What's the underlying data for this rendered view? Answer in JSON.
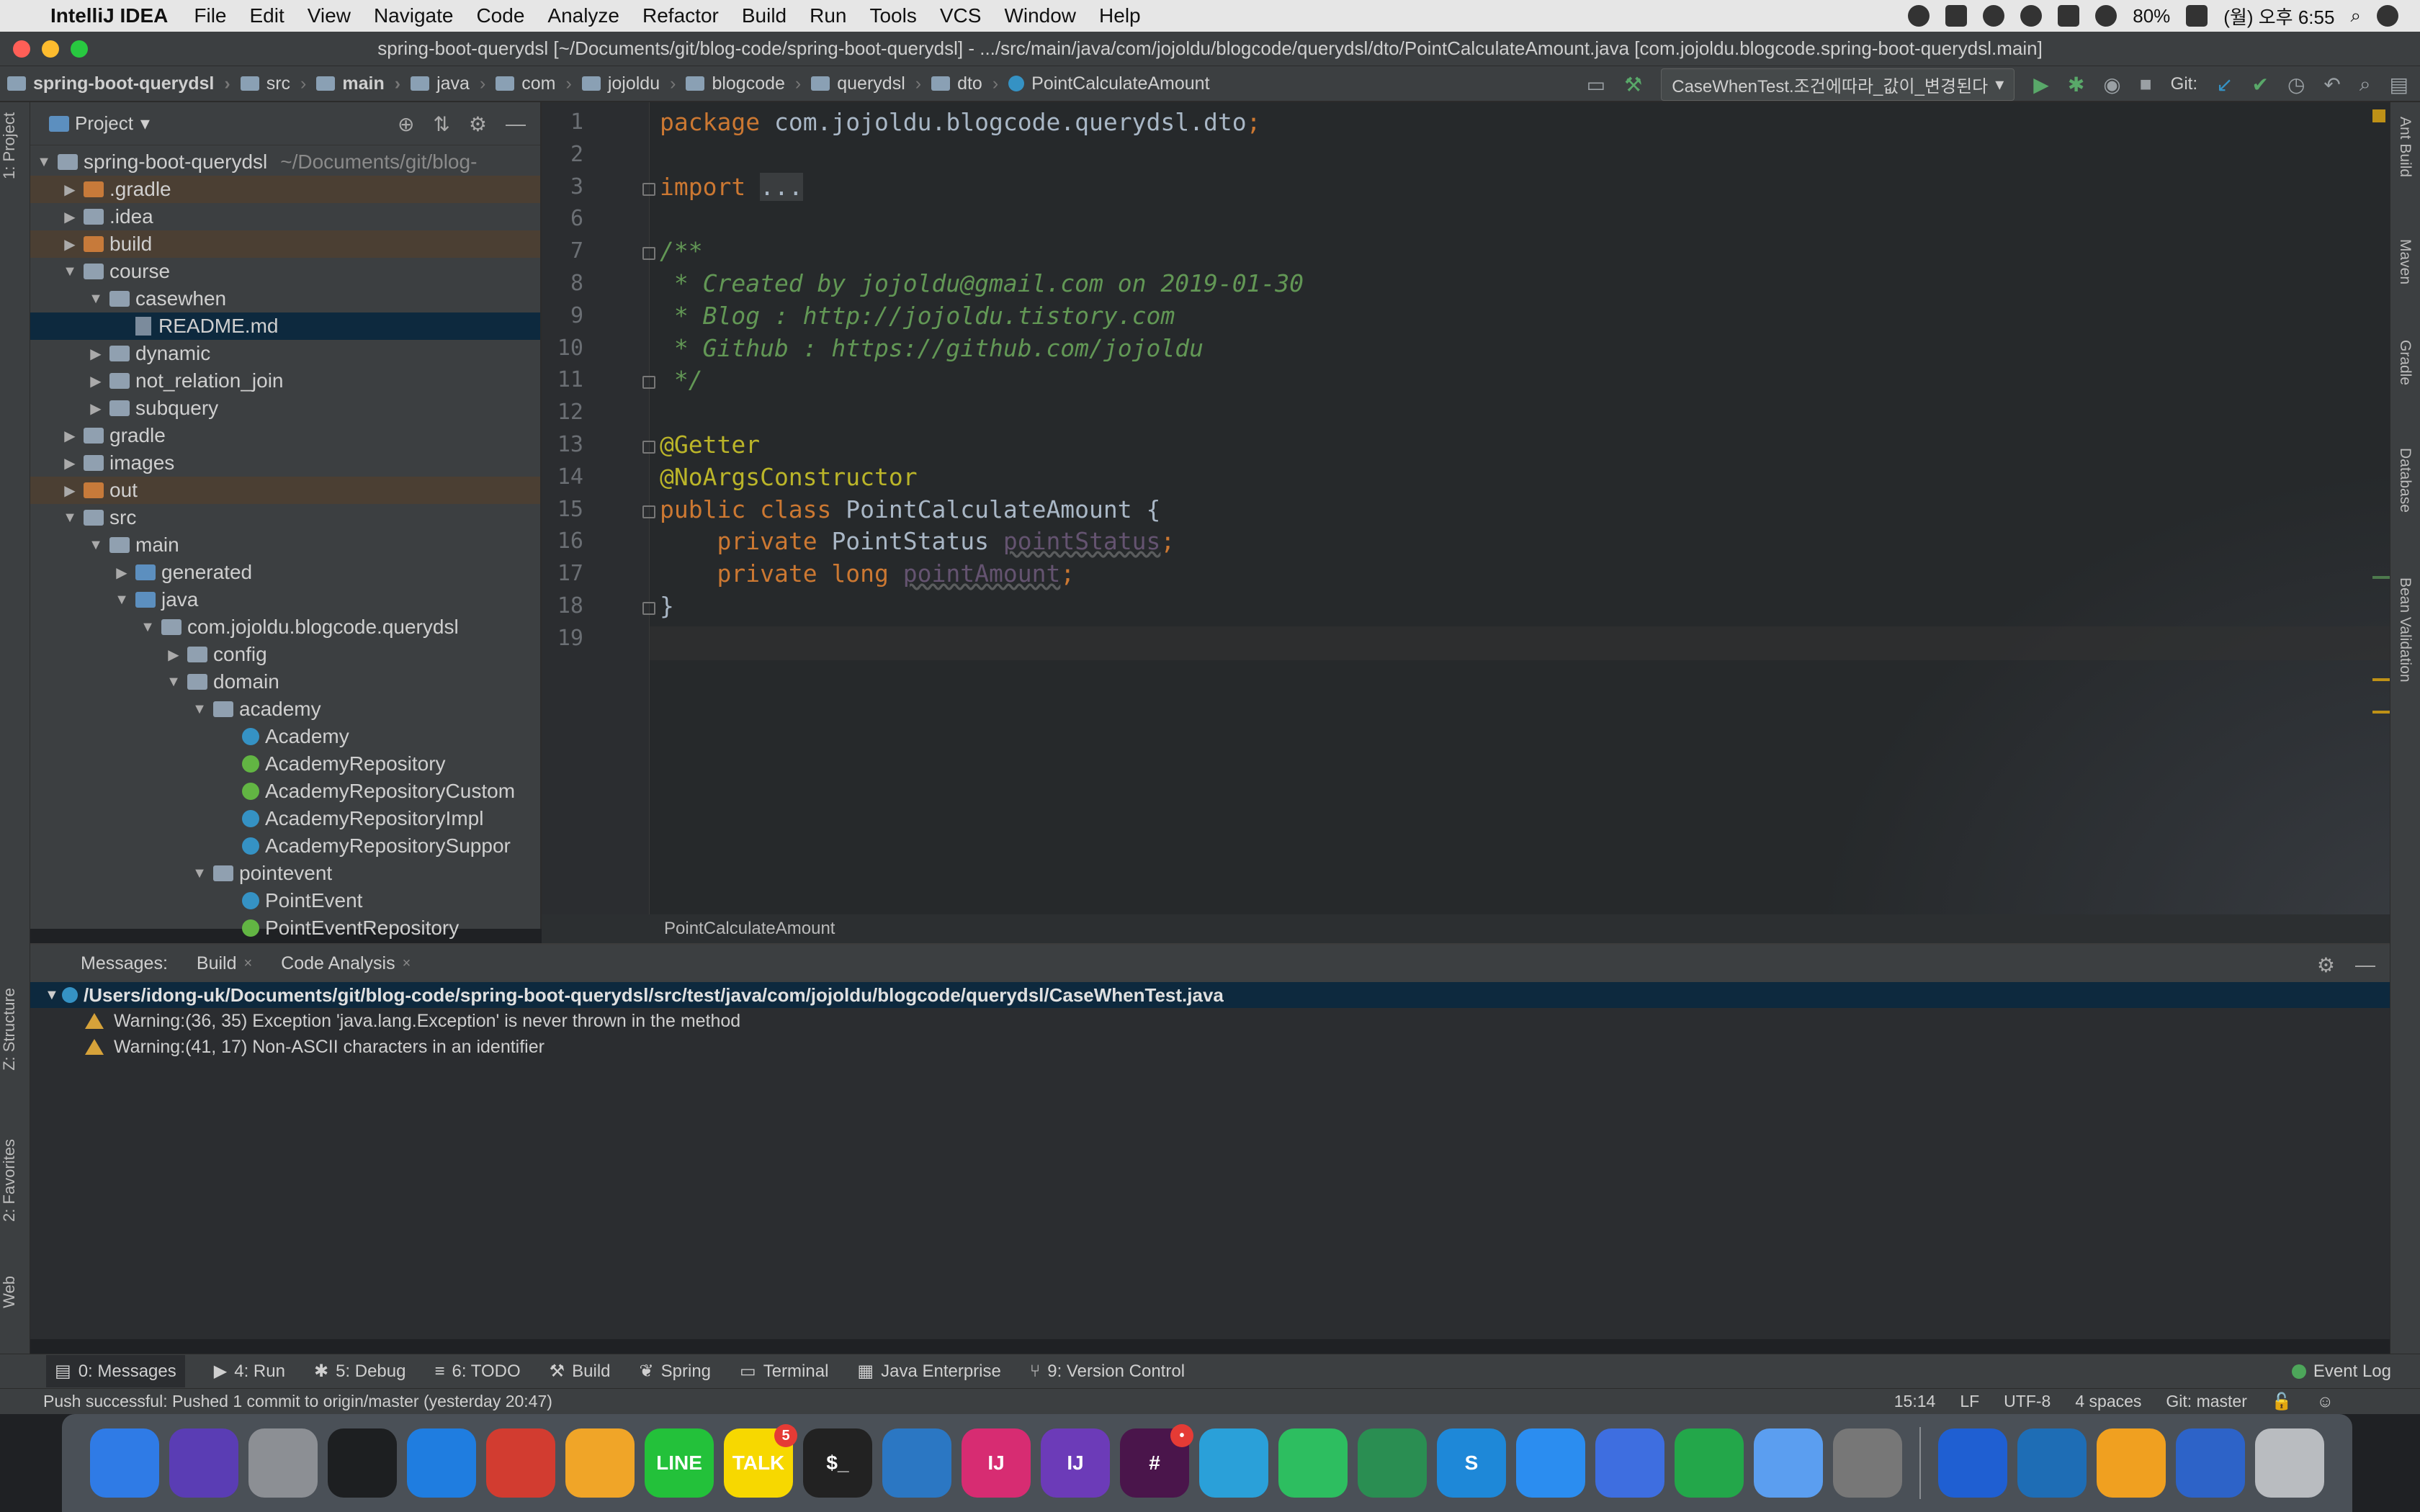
{
  "menubar": {
    "app_name": "IntelliJ IDEA",
    "items": [
      "File",
      "Edit",
      "View",
      "Navigate",
      "Code",
      "Analyze",
      "Refactor",
      "Build",
      "Run",
      "Tools",
      "VCS",
      "Window",
      "Help"
    ],
    "battery": "80%",
    "clock": "(월) 오후 6:55"
  },
  "window": {
    "title": "spring-boot-querydsl [~/Documents/git/blog-code/spring-boot-querydsl] - .../src/main/java/com/jojoldu/blogcode/querydsl/dto/PointCalculateAmount.java [com.jojoldu.blogcode.spring-boot-querydsl.main]"
  },
  "breadcrumbs": [
    "spring-boot-querydsl",
    "src",
    "main",
    "java",
    "com",
    "jojoldu",
    "blogcode",
    "querydsl",
    "dto",
    "PointCalculateAmount"
  ],
  "nav": {
    "run_config": "CaseWhenTest.조건에따라_값이_변경된다",
    "git_label": "Git:"
  },
  "left_stripe": {
    "project": "1: Project",
    "structure": "Z: Structure",
    "favorites": "2: Favorites",
    "web": "Web"
  },
  "right_stripe": [
    "Ant Build",
    "Maven",
    "Gradle",
    "Database",
    "Bean Validation"
  ],
  "project_panel": {
    "title": "Project",
    "root_name": "spring-boot-querydsl",
    "root_path": "~/Documents/git/blog-",
    "tree": [
      {
        "label": ".gradle",
        "depth": 1,
        "type": "folder-orange",
        "arrow": "right"
      },
      {
        "label": ".idea",
        "depth": 1,
        "type": "folder",
        "arrow": "right"
      },
      {
        "label": "build",
        "depth": 1,
        "type": "folder-orange",
        "arrow": "right"
      },
      {
        "label": "course",
        "depth": 1,
        "type": "folder",
        "arrow": "down"
      },
      {
        "label": "casewhen",
        "depth": 2,
        "type": "folder",
        "arrow": "down"
      },
      {
        "label": "README.md",
        "depth": 3,
        "type": "md",
        "arrow": ""
      },
      {
        "label": "dynamic",
        "depth": 2,
        "type": "folder",
        "arrow": "right"
      },
      {
        "label": "not_relation_join",
        "depth": 2,
        "type": "folder",
        "arrow": "right"
      },
      {
        "label": "subquery",
        "depth": 2,
        "type": "folder",
        "arrow": "right"
      },
      {
        "label": "gradle",
        "depth": 1,
        "type": "folder",
        "arrow": "right"
      },
      {
        "label": "images",
        "depth": 1,
        "type": "folder",
        "arrow": "right"
      },
      {
        "label": "out",
        "depth": 1,
        "type": "folder-orange",
        "arrow": "right"
      },
      {
        "label": "src",
        "depth": 1,
        "type": "folder",
        "arrow": "down"
      },
      {
        "label": "main",
        "depth": 2,
        "type": "folder",
        "arrow": "down"
      },
      {
        "label": "generated",
        "depth": 3,
        "type": "folder-blue",
        "arrow": "right"
      },
      {
        "label": "java",
        "depth": 3,
        "type": "folder-blue",
        "arrow": "down"
      },
      {
        "label": "com.jojoldu.blogcode.querydsl",
        "depth": 4,
        "type": "folder",
        "arrow": "down"
      },
      {
        "label": "config",
        "depth": 5,
        "type": "folder",
        "arrow": "right"
      },
      {
        "label": "domain",
        "depth": 5,
        "type": "folder",
        "arrow": "down"
      },
      {
        "label": "academy",
        "depth": 6,
        "type": "folder",
        "arrow": "down"
      },
      {
        "label": "Academy",
        "depth": 7,
        "type": "class",
        "arrow": ""
      },
      {
        "label": "AcademyRepository",
        "depth": 7,
        "type": "interface",
        "arrow": ""
      },
      {
        "label": "AcademyRepositoryCustom",
        "depth": 7,
        "type": "interface",
        "arrow": ""
      },
      {
        "label": "AcademyRepositoryImpl",
        "depth": 7,
        "type": "class",
        "arrow": ""
      },
      {
        "label": "AcademyRepositorySuppor",
        "depth": 7,
        "type": "class",
        "arrow": ""
      },
      {
        "label": "pointevent",
        "depth": 6,
        "type": "folder",
        "arrow": "down"
      },
      {
        "label": "PointEvent",
        "depth": 7,
        "type": "class",
        "arrow": ""
      },
      {
        "label": "PointEventRepository",
        "depth": 7,
        "type": "interface",
        "arrow": ""
      }
    ]
  },
  "editor": {
    "filename": "PointCalculateAmount",
    "lines": [
      {
        "n": "1",
        "html": "<span class='kw'>package</span> <span class='plain'>com.jojoldu.blogcode.querydsl.dto</span><span class='kw'>;</span>"
      },
      {
        "n": "2",
        "html": ""
      },
      {
        "n": "3",
        "html": "<span class='kw'>import</span> <span class='plain' style='background:#3a3d3f'>...</span>"
      },
      {
        "n": "6",
        "html": ""
      },
      {
        "n": "7",
        "html": "<span class='cmt'>/**</span>"
      },
      {
        "n": "8",
        "html": "<span class='cmt'> * Created by jojoldu@gmail.com on 2019-01-30</span>"
      },
      {
        "n": "9",
        "html": "<span class='cmt'> * Blog : http://jojoldu.tistory.com</span>"
      },
      {
        "n": "10",
        "html": "<span class='cmt'> * Github : https://github.com/jojoldu</span>"
      },
      {
        "n": "11",
        "html": "<span class='cmt'> */</span>"
      },
      {
        "n": "12",
        "html": ""
      },
      {
        "n": "13",
        "html": "<span class='ann'>@Getter</span>"
      },
      {
        "n": "14",
        "html": "<span class='ann'>@NoArgsConstructor</span>"
      },
      {
        "n": "15",
        "html": "<span class='kw'>public class</span> <span class='plain'>PointCalculateAmount {</span>"
      },
      {
        "n": "16",
        "html": "    <span class='kw'>private</span> <span class='plain'>PointStatus</span> <span class='field'>pointStatus</span><span class='kw'>;</span>"
      },
      {
        "n": "17",
        "html": "    <span class='kw'>private long</span> <span class='field'>pointAmount</span><span class='kw'>;</span>"
      },
      {
        "n": "18",
        "html": "<span class='plain'>}</span>"
      },
      {
        "n": "19",
        "html": ""
      }
    ]
  },
  "messages": {
    "label": "Messages:",
    "tabs": [
      "Build",
      "Code Analysis"
    ],
    "path": "/Users/idong-uk/Documents/git/blog-code/spring-boot-querydsl/src/test/java/com/jojoldu/blogcode/querydsl/CaseWhenTest.java",
    "warnings": [
      "Warning:(36, 35)  Exception 'java.lang.Exception' is never thrown in the method",
      "Warning:(41, 17)  Non-ASCII characters in an identifier"
    ]
  },
  "tool_windows": [
    "0: Messages",
    "4: Run",
    "5: Debug",
    "6: TODO",
    "Build",
    "Spring",
    "Terminal",
    "Java Enterprise",
    "9: Version Control"
  ],
  "event_log": "Event Log",
  "status": {
    "message": "Push successful: Pushed 1 commit to origin/master (yesterday 20:47)",
    "position": "15:14",
    "line_sep": "LF",
    "encoding": "UTF-8",
    "indent": "4 spaces",
    "git": "Git: master"
  },
  "dock": [
    {
      "name": "finder",
      "color": "#2f7be6",
      "label": ""
    },
    {
      "name": "siri",
      "color": "#5a3db4",
      "label": ""
    },
    {
      "name": "launchpad",
      "color": "#8c8f94",
      "label": ""
    },
    {
      "name": "activity-monitor",
      "color": "#1d1f21",
      "label": ""
    },
    {
      "name": "safari",
      "color": "#1f7de0",
      "label": ""
    },
    {
      "name": "chrome",
      "color": "#d23c30",
      "label": ""
    },
    {
      "name": "chrome-canary",
      "color": "#f0a528",
      "label": ""
    },
    {
      "name": "line",
      "color": "#23c13a",
      "label": "LINE"
    },
    {
      "name": "kakaotalk",
      "color": "#f7d800",
      "label": "TALK",
      "badge": "5"
    },
    {
      "name": "terminal",
      "color": "#222",
      "label": "$_"
    },
    {
      "name": "vscode",
      "color": "#2b77c3",
      "label": ""
    },
    {
      "name": "intellij-idea",
      "color": "#d72c72",
      "label": "IJ"
    },
    {
      "name": "intellij-idea-2",
      "color": "#6c3bb8",
      "label": "IJ"
    },
    {
      "name": "slack",
      "color": "#4a154b",
      "label": "#",
      "badge": "•"
    },
    {
      "name": "telegram",
      "color": "#2aa0d9",
      "label": ""
    },
    {
      "name": "evernote",
      "color": "#2dbe60",
      "label": ""
    },
    {
      "name": "browser",
      "color": "#2a8e52",
      "label": ""
    },
    {
      "name": "s-app",
      "color": "#1e88d8",
      "label": "S"
    },
    {
      "name": "app-store",
      "color": "#2b8df0",
      "label": ""
    },
    {
      "name": "keynote",
      "color": "#3e6ee0",
      "label": ""
    },
    {
      "name": "numbers",
      "color": "#23a74a",
      "label": ""
    },
    {
      "name": "messages",
      "color": "#5b9ef0",
      "label": ""
    },
    {
      "name": "system-preferences",
      "color": "#777",
      "label": ""
    },
    {
      "name": "maps-pin",
      "color": "#1f5fd2",
      "label": ""
    },
    {
      "name": "vscode-2",
      "color": "#1e6db5",
      "label": ""
    },
    {
      "name": "reeder",
      "color": "#f0a020",
      "label": ""
    },
    {
      "name": "downloads",
      "color": "#2d63c8",
      "label": ""
    },
    {
      "name": "trash",
      "color": "#b9bcc0",
      "label": ""
    }
  ]
}
